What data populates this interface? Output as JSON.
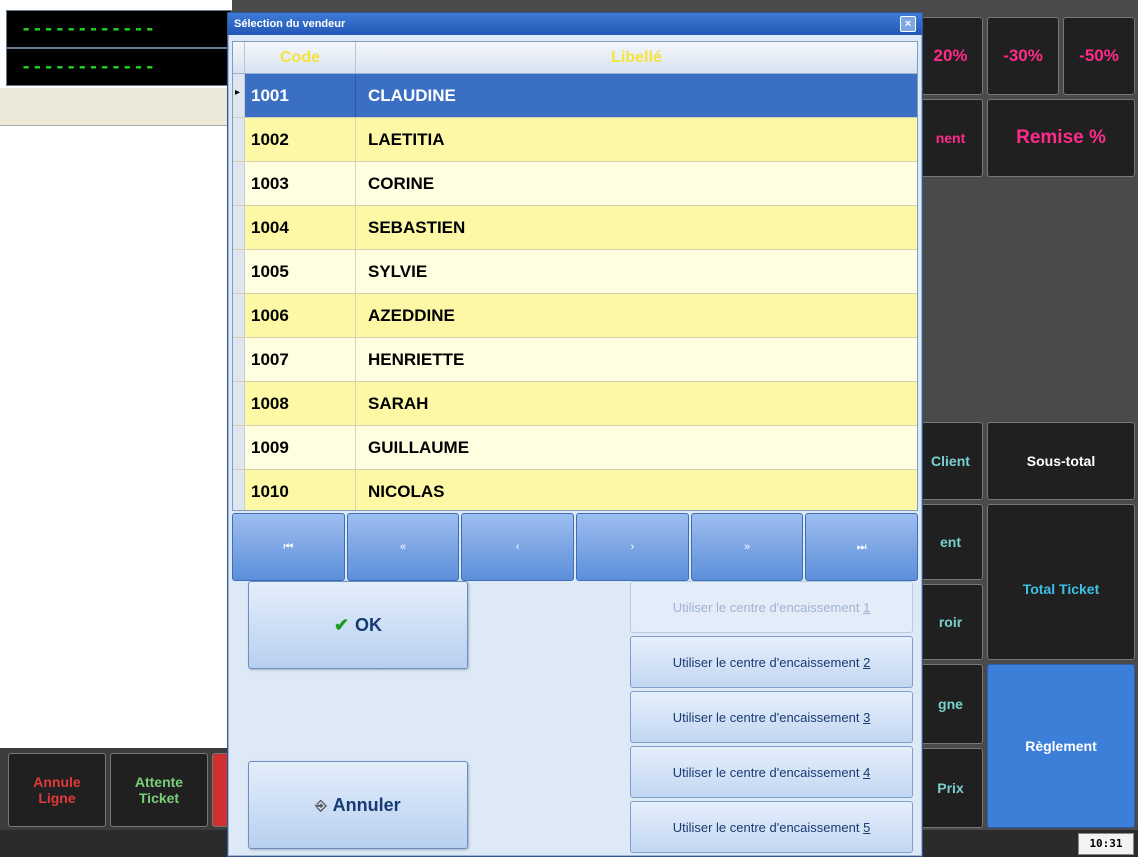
{
  "background": {
    "lcd_line1": "------------",
    "lcd_line2": "------------",
    "left_buttons": [
      {
        "label1": "Annule",
        "label2": "Ligne",
        "color": "#e03a3a"
      },
      {
        "label1": "Attente",
        "label2": "Ticket",
        "color": "#7ad07a"
      }
    ],
    "right_buttons": {
      "pct20": "20%",
      "pct30": "-30%",
      "pct50": "-50%",
      "nent": "nent",
      "remise": "Remise %",
      "client": "Client",
      "sous_total": "Sous-total",
      "ent": "ent",
      "total_ticket": "Total Ticket",
      "roir": "roir",
      "gne": "gne",
      "reglement": "Règlement",
      "prix": "Prix"
    },
    "clock": "10:31"
  },
  "dialog": {
    "title": "Sélection du vendeur",
    "close_label": "×",
    "columns": {
      "code": "Code",
      "label": "Libellé"
    },
    "rows": [
      {
        "code": "1001",
        "label": "CLAUDINE"
      },
      {
        "code": "1002",
        "label": "LAETITIA"
      },
      {
        "code": "1003",
        "label": "CORINE"
      },
      {
        "code": "1004",
        "label": "SEBASTIEN"
      },
      {
        "code": "1005",
        "label": "SYLVIE"
      },
      {
        "code": "1006",
        "label": "AZEDDINE"
      },
      {
        "code": "1007",
        "label": "HENRIETTE"
      },
      {
        "code": "1008",
        "label": "SARAH"
      },
      {
        "code": "1009",
        "label": "GUILLAUME"
      },
      {
        "code": "1010",
        "label": "NICOLAS"
      }
    ],
    "selected_code": "1001",
    "nav": {
      "first": "⏮",
      "prev_page": "«",
      "prev": "‹",
      "next": "›",
      "next_page": "»",
      "last": "⏭"
    },
    "ok_label": "OK",
    "cancel_label": "Annuler",
    "cc_prefix": "Utiliser le centre d'encaissement",
    "cc_numbers": [
      "1",
      "2",
      "3",
      "4",
      "5"
    ]
  }
}
